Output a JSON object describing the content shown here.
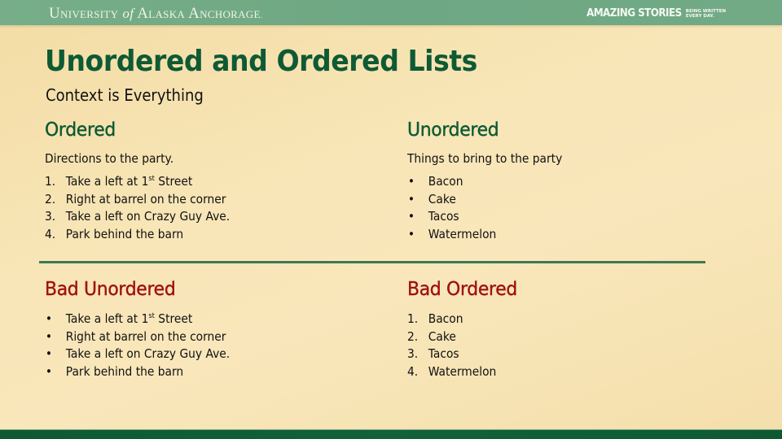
{
  "header": {
    "logo_university": "University",
    "logo_of": "of",
    "logo_rest": "Alaska Anchorage",
    "logo_mark": ".",
    "tagline_big": "AMAZING STORIES",
    "tagline_small_1": "BEING WRITTEN",
    "tagline_small_2": "EVERY DAY."
  },
  "slide": {
    "title": "Unordered and Ordered Lists",
    "subtitle": "Context is Everything"
  },
  "sections": {
    "ordered": {
      "heading": "Ordered",
      "description": "Directions to the party.",
      "items": [
        {
          "marker": "1.",
          "text": "Take a left at 1",
          "sup": "st",
          "after": " Street"
        },
        {
          "marker": "2.",
          "text": "Right at barrel on the corner"
        },
        {
          "marker": "3.",
          "text": "Take a left on Crazy Guy Ave."
        },
        {
          "marker": "4.",
          "text": "Park behind the barn"
        }
      ]
    },
    "unordered": {
      "heading": "Unordered",
      "description": "Things to bring to the party",
      "items": [
        {
          "marker": "•",
          "text": "Bacon"
        },
        {
          "marker": "•",
          "text": "Cake"
        },
        {
          "marker": "•",
          "text": "Tacos"
        },
        {
          "marker": "•",
          "text": "Watermelon"
        }
      ]
    },
    "bad_unordered": {
      "heading": "Bad Unordered",
      "items": [
        {
          "marker": "•",
          "text": "Take a left at 1",
          "sup": "st",
          "after": " Street"
        },
        {
          "marker": "•",
          "text": "Right at barrel on the corner"
        },
        {
          "marker": "•",
          "text": "Take a left on Crazy Guy Ave."
        },
        {
          "marker": "•",
          "text": "Park behind the barn"
        }
      ]
    },
    "bad_ordered": {
      "heading": "Bad Ordered",
      "items": [
        {
          "marker": "1.",
          "text": "Bacon"
        },
        {
          "marker": "2.",
          "text": "Cake"
        },
        {
          "marker": "3.",
          "text": "Tacos"
        },
        {
          "marker": "4.",
          "text": "Watermelon"
        }
      ]
    }
  },
  "colors": {
    "heading_green": "#0e5a34",
    "heading_red": "#a01212",
    "band_green": "#72aa86",
    "divider_green": "#3b7a55"
  }
}
